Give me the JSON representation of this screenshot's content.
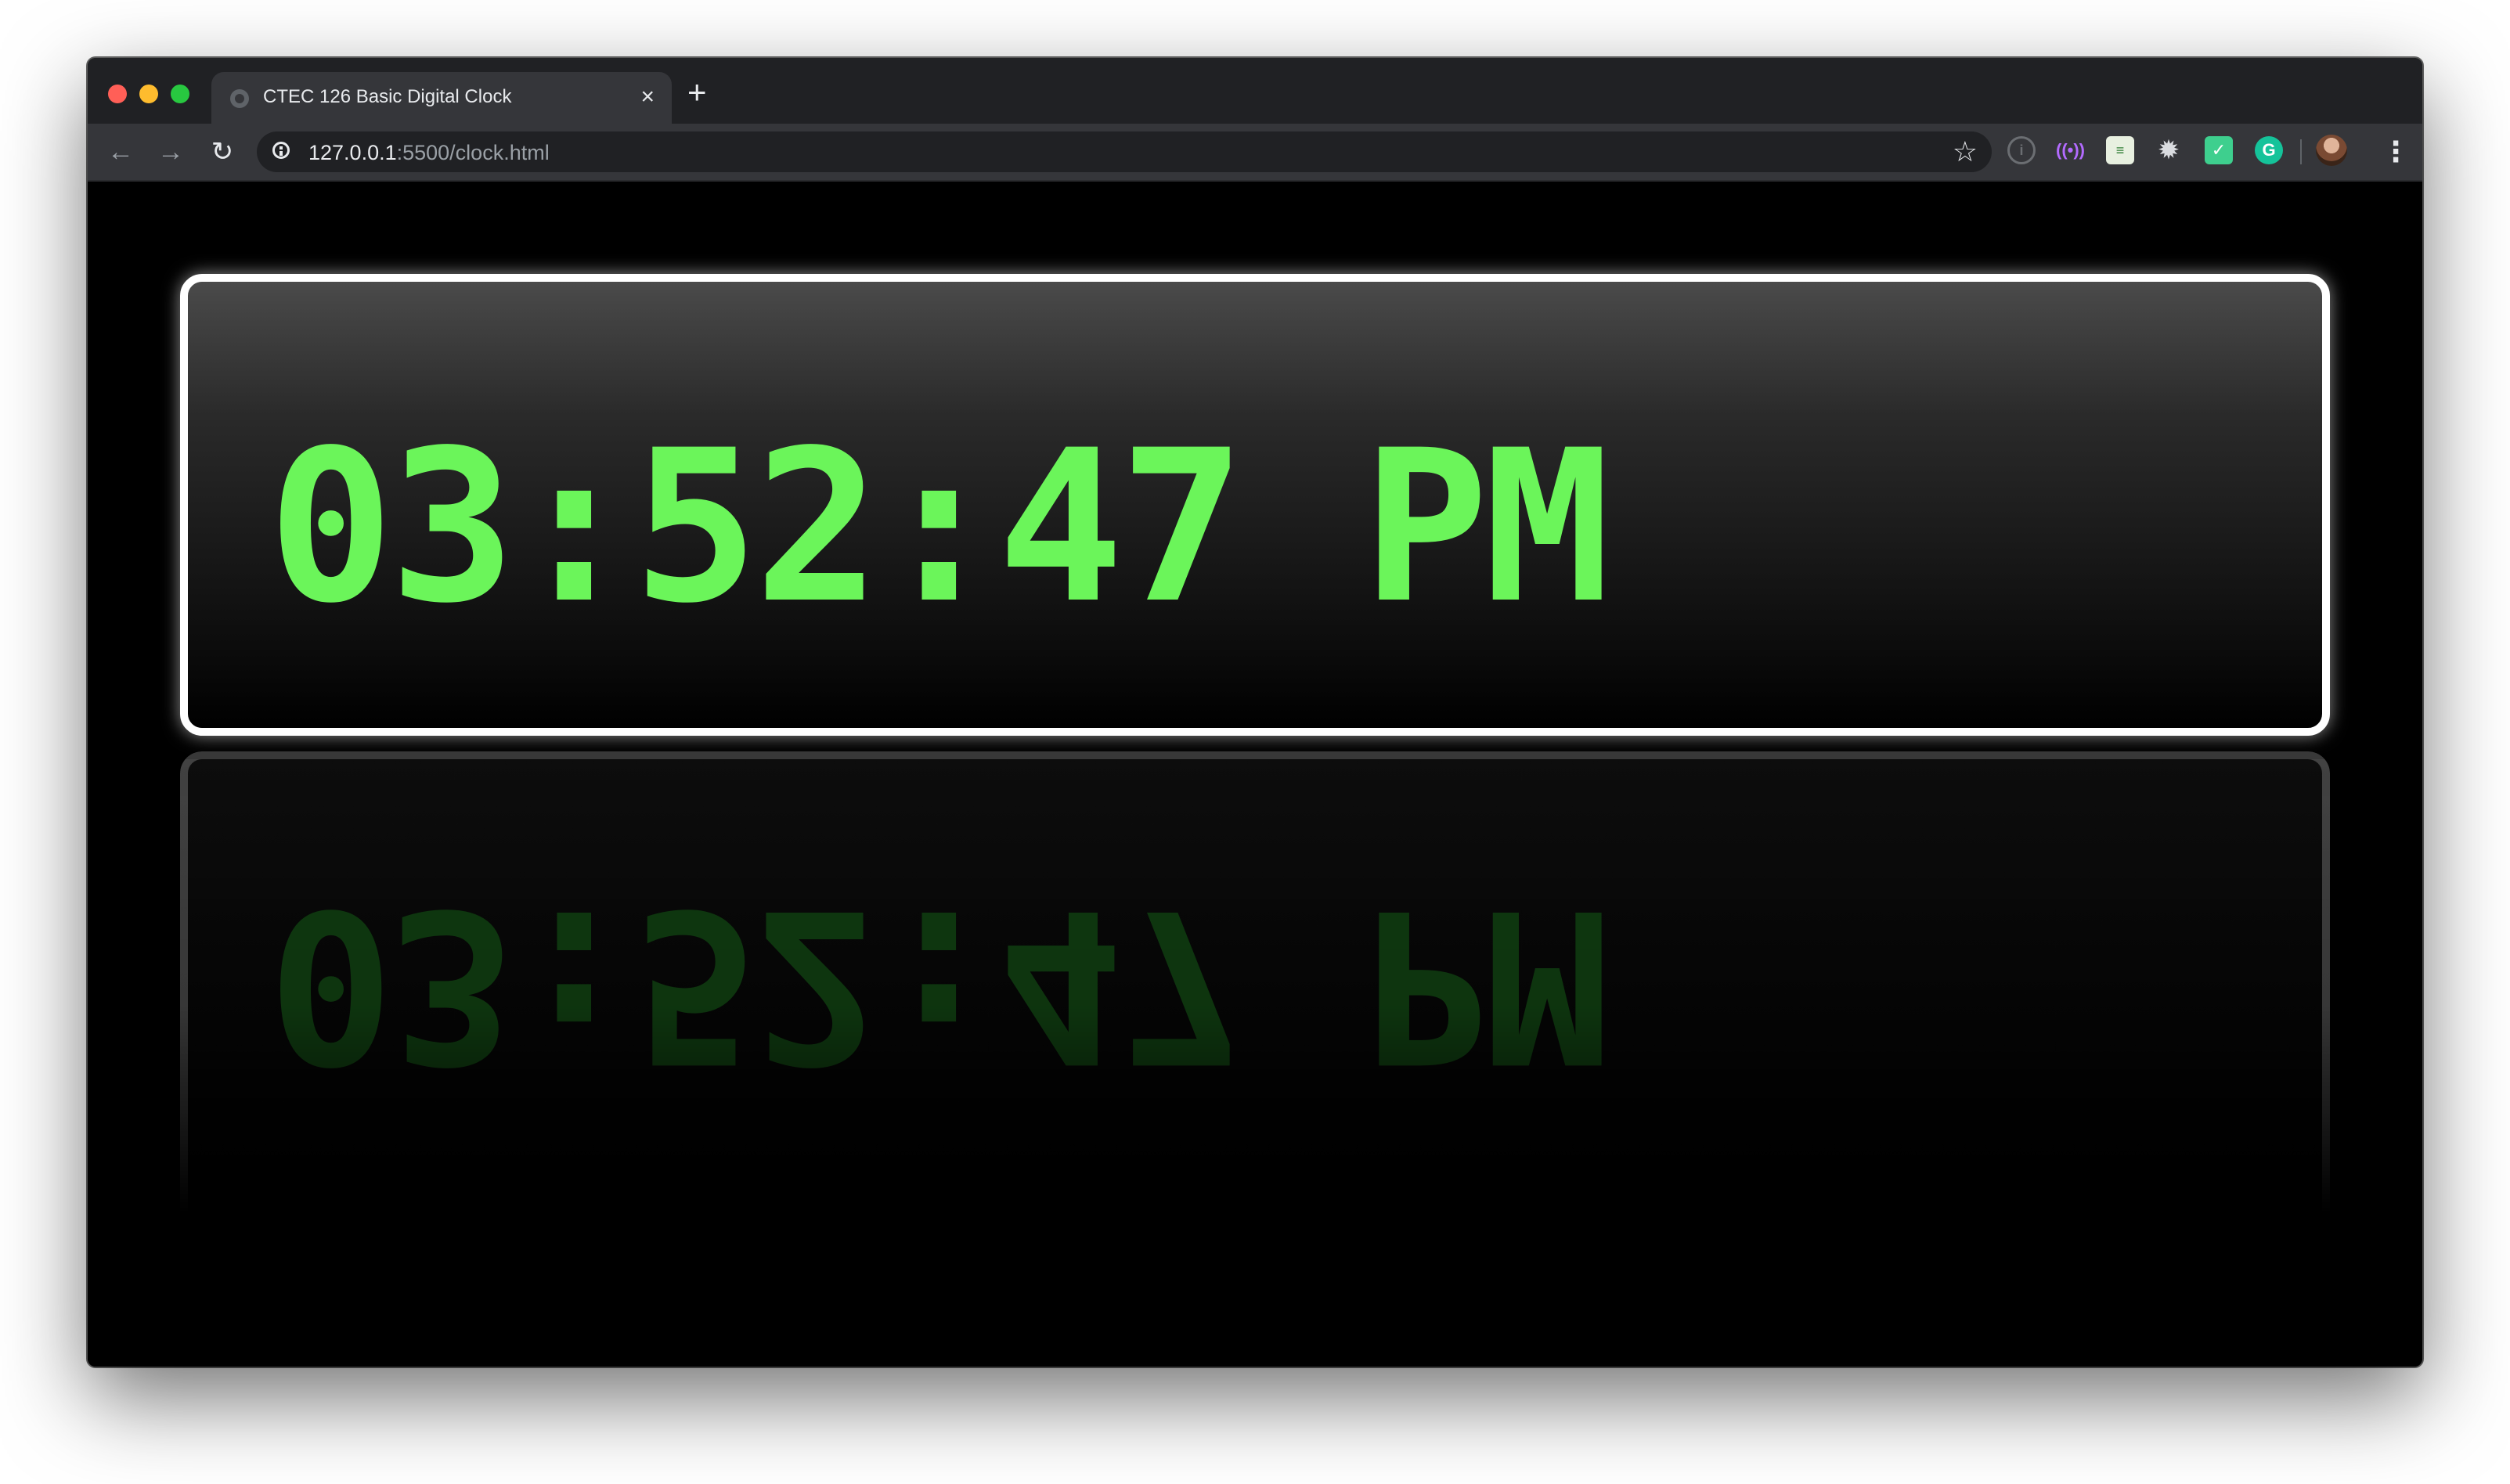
{
  "browser": {
    "tab": {
      "title": "CTEC 126 Basic Digital Clock",
      "close_glyph": "×"
    },
    "new_tab_glyph": "+",
    "toolbar": {
      "back_glyph": "←",
      "forward_glyph": "→",
      "reload_glyph": "↻",
      "url_host": "127.0.0.1",
      "url_path": ":5500/clock.html",
      "bookmark_glyph": "☆",
      "menu_glyph": "⋮"
    },
    "extensions": {
      "info_glyph": "i",
      "broadcast_glyph": "((•))",
      "sheet_glyph": "≡",
      "gear_glyph": "✹",
      "save_glyph": "✓",
      "grammarly_glyph": "G"
    },
    "icons": [
      "back-arrow-icon",
      "forward-arrow-icon",
      "reload-icon",
      "info-icon",
      "star-icon",
      "menu-icon"
    ]
  },
  "clock": {
    "time": "03:52:47 PM",
    "digit_color": "#6bf55a",
    "border_color": "#ffffff"
  }
}
